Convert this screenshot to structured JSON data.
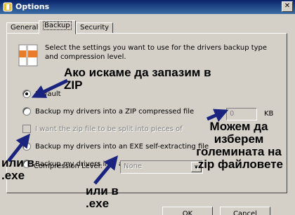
{
  "window": {
    "title": "Options",
    "close_glyph": "✕"
  },
  "tabs": [
    {
      "label": "General",
      "active": false
    },
    {
      "label": "Backup",
      "active": true
    },
    {
      "label": "Security",
      "active": false
    }
  ],
  "backup": {
    "intro": "Select the settings you want to use for the drivers backup type and compression level.",
    "options": [
      {
        "label": "Default",
        "selected": true
      },
      {
        "label": "Backup my drivers into a ZIP compressed file",
        "selected": false
      },
      {
        "label": "I want the zip file to be split into pieces of",
        "checked": false,
        "disabled": true
      },
      {
        "label": "Backup my drivers into an EXE self-extracting file",
        "selected": false
      },
      {
        "label": "Backup my drivers into an EXE auto-installer",
        "selected": false
      }
    ],
    "split_value": "0",
    "split_unit": "KB",
    "compression_label": "Compression Level:",
    "compression_value": "None"
  },
  "buttons": {
    "ok": "OK",
    "cancel": "Cancel"
  },
  "annotations": {
    "zip_note": "Ако искаме да запазим в ZIP",
    "size_note": "Можем да изберем големината на .zip файловете",
    "exe_note_1": "или в .exe",
    "exe_note_2": "или в .exe"
  },
  "colors": {
    "annotation_arrow": "#1a237e",
    "title_bar": "#0a246a",
    "dialog_face": "#d4d0c8"
  }
}
